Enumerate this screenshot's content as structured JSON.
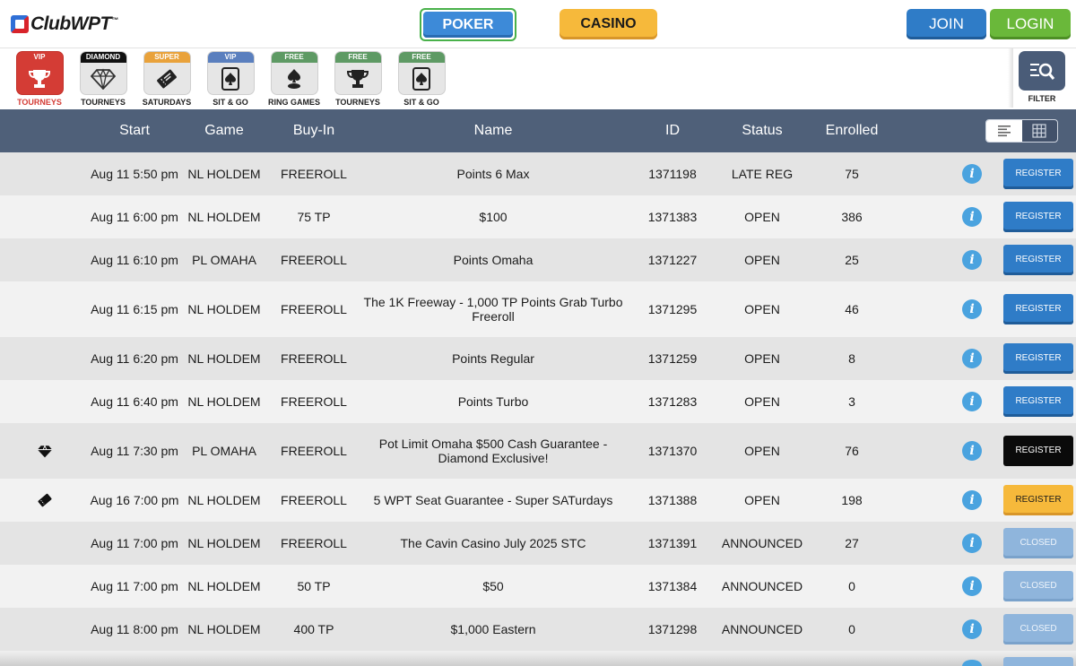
{
  "app": {
    "logo_text": "ClubWPT",
    "logo_tm": "™"
  },
  "header": {
    "poker_label": "POKER",
    "casino_label": "CASINO",
    "join_label": "JOIN",
    "login_label": "LOGIN"
  },
  "categories": [
    {
      "badge": "VIP",
      "label": "TOURNEYS",
      "icon": "trophy-icon",
      "glyph": "🏆",
      "badge_color": "#d43c35",
      "active": true
    },
    {
      "badge": "DIAMOND",
      "label": "TOURNEYS",
      "icon": "diamond-icon",
      "glyph": "◆",
      "badge_color": "#111111"
    },
    {
      "badge": "SUPER",
      "label": "SATURDAYS",
      "icon": "ticket-icon",
      "glyph": "🎟",
      "badge_color": "#e9a23b"
    },
    {
      "badge": "VIP",
      "label": "SIT & GO",
      "icon": "spade-card-icon",
      "glyph": "♠",
      "badge_color": "#5a7fbe"
    },
    {
      "badge": "FREE",
      "label": "RING GAMES",
      "icon": "spade-chip-icon",
      "glyph": "♠",
      "badge_color": "#5e9a64"
    },
    {
      "badge": "FREE",
      "label": "TOURNEYS",
      "icon": "trophy-icon",
      "glyph": "🏆",
      "badge_color": "#5e9a64"
    },
    {
      "badge": "FREE",
      "label": "SIT & GO",
      "icon": "spade-card-icon",
      "glyph": "♠",
      "badge_color": "#5e9a64"
    }
  ],
  "filter": {
    "label": "FILTER",
    "icon": "filter-search-icon"
  },
  "table": {
    "headers": {
      "start": "Start",
      "game": "Game",
      "buyin": "Buy-In",
      "name": "Name",
      "id": "ID",
      "status": "Status",
      "enrolled": "Enrolled"
    },
    "register_label": "REGISTER",
    "closed_label": "CLOSED",
    "rows": [
      {
        "icon": "",
        "start": "Aug 11 5:50 pm",
        "game": "NL HOLDEM",
        "buyin": "FREEROLL",
        "name": "Points 6 Max",
        "id": "1371198",
        "status": "LATE REG",
        "enrolled": "75",
        "action": "register"
      },
      {
        "icon": "",
        "start": "Aug 11 6:00 pm",
        "game": "NL HOLDEM",
        "buyin": "75 TP",
        "name": "$100",
        "id": "1371383",
        "status": "OPEN",
        "enrolled": "386",
        "action": "register"
      },
      {
        "icon": "",
        "start": "Aug 11 6:10 pm",
        "game": "PL OMAHA",
        "buyin": "FREEROLL",
        "name": "Points Omaha",
        "id": "1371227",
        "status": "OPEN",
        "enrolled": "25",
        "action": "register"
      },
      {
        "icon": "",
        "start": "Aug 11 6:15 pm",
        "game": "NL HOLDEM",
        "buyin": "FREEROLL",
        "name": "The 1K Freeway - 1,000 TP Points Grab Turbo Freeroll",
        "id": "1371295",
        "status": "OPEN",
        "enrolled": "46",
        "action": "register",
        "tall": true
      },
      {
        "icon": "",
        "start": "Aug 11 6:20 pm",
        "game": "NL HOLDEM",
        "buyin": "FREEROLL",
        "name": "Points Regular",
        "id": "1371259",
        "status": "OPEN",
        "enrolled": "8",
        "action": "register"
      },
      {
        "icon": "",
        "start": "Aug 11 6:40 pm",
        "game": "NL HOLDEM",
        "buyin": "FREEROLL",
        "name": "Points Turbo",
        "id": "1371283",
        "status": "OPEN",
        "enrolled": "3",
        "action": "register"
      },
      {
        "icon": "diamond-icon",
        "start": "Aug 11 7:30 pm",
        "game": "PL OMAHA",
        "buyin": "FREEROLL",
        "name": "Pot Limit Omaha $500 Cash Guarantee - Diamond Exclusive!",
        "id": "1371370",
        "status": "OPEN",
        "enrolled": "76",
        "action": "register-black",
        "tall": true
      },
      {
        "icon": "ticket-icon",
        "start": "Aug 16 7:00 pm",
        "game": "NL HOLDEM",
        "buyin": "FREEROLL",
        "name": "5 WPT Seat Guarantee - Super SATurdays",
        "id": "1371388",
        "status": "OPEN",
        "enrolled": "198",
        "action": "register-gold"
      },
      {
        "icon": "",
        "start": "Aug 11 7:00 pm",
        "game": "NL HOLDEM",
        "buyin": "FREEROLL",
        "name": "The Cavin Casino July 2025 STC",
        "id": "1371391",
        "status": "ANNOUNCED",
        "enrolled": "27",
        "action": "closed"
      },
      {
        "icon": "",
        "start": "Aug 11 7:00 pm",
        "game": "NL HOLDEM",
        "buyin": "50 TP",
        "name": "$50",
        "id": "1371384",
        "status": "ANNOUNCED",
        "enrolled": "0",
        "action": "closed"
      },
      {
        "icon": "",
        "start": "Aug 11 8:00 pm",
        "game": "NL HOLDEM",
        "buyin": "400 TP",
        "name": "$1,000 Eastern",
        "id": "1371298",
        "status": "ANNOUNCED",
        "enrolled": "0",
        "action": "closed"
      }
    ]
  }
}
